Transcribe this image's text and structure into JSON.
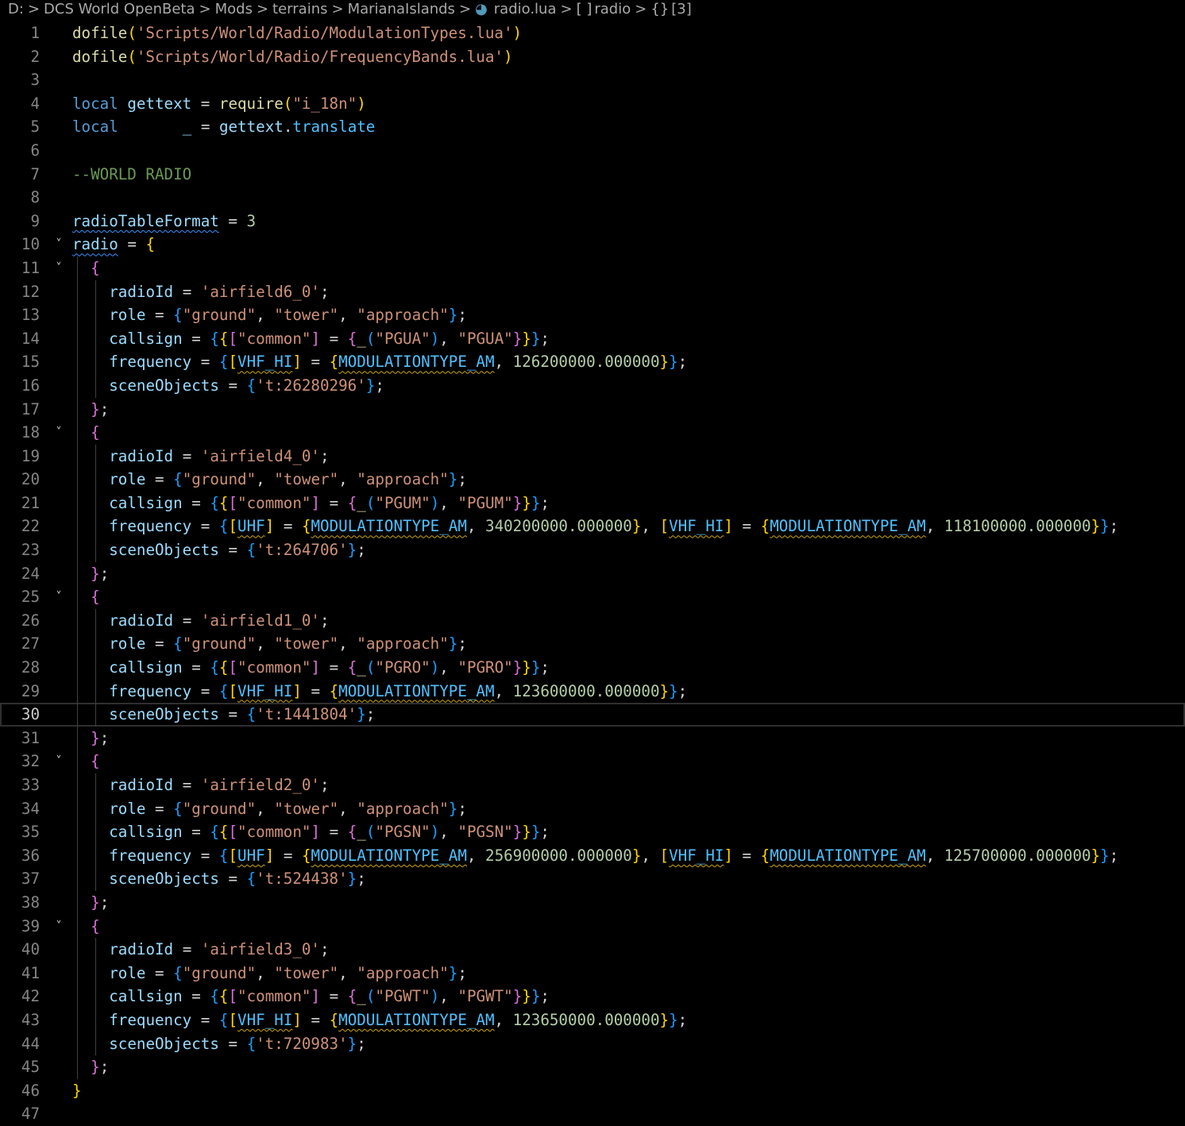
{
  "breadcrumb": {
    "items": [
      "D:",
      "DCS World OpenBeta",
      "Mods",
      "terrains",
      "MarianaIslands",
      "radio.lua",
      "radio",
      "[3]"
    ],
    "icons": {
      "file": "lua-file-icon",
      "array": "array-icon",
      "object": "object-icon"
    }
  },
  "editor": {
    "current_line": 30,
    "lines": [
      {
        "n": "1",
        "text": "dofile('Scripts/World/Radio/ModulationTypes.lua')"
      },
      {
        "n": "2",
        "text": "dofile('Scripts/World/Radio/FrequencyBands.lua')"
      },
      {
        "n": "3",
        "text": ""
      },
      {
        "n": "4",
        "text": "local gettext = require(\"i_18n\")"
      },
      {
        "n": "5",
        "text": "local       _ = gettext.translate"
      },
      {
        "n": "6",
        "text": ""
      },
      {
        "n": "7",
        "text": "--WORLD RADIO"
      },
      {
        "n": "8",
        "text": ""
      },
      {
        "n": "9",
        "text": "radioTableFormat = 3"
      },
      {
        "n": "10",
        "text": "radio = {"
      },
      {
        "n": "11",
        "text": "  {"
      },
      {
        "n": "12",
        "text": "    radioId = 'airfield6_0';"
      },
      {
        "n": "13",
        "text": "    role = {\"ground\", \"tower\", \"approach\"};"
      },
      {
        "n": "14",
        "text": "    callsign = {{[\"common\"] = {_(\"PGUA\"), \"PGUA\"}}};"
      },
      {
        "n": "15",
        "text": "    frequency = {[VHF_HI] = {MODULATIONTYPE_AM, 126200000.000000}};"
      },
      {
        "n": "16",
        "text": "    sceneObjects = {'t:26280296'};"
      },
      {
        "n": "17",
        "text": "  };"
      },
      {
        "n": "18",
        "text": "  {"
      },
      {
        "n": "19",
        "text": "    radioId = 'airfield4_0';"
      },
      {
        "n": "20",
        "text": "    role = {\"ground\", \"tower\", \"approach\"};"
      },
      {
        "n": "21",
        "text": "    callsign = {{[\"common\"] = {_(\"PGUM\"), \"PGUM\"}}};"
      },
      {
        "n": "22",
        "text": "    frequency = {[UHF] = {MODULATIONTYPE_AM, 340200000.000000}, [VHF_HI] = {MODULATIONTYPE_AM, 118100000.000000}};"
      },
      {
        "n": "23",
        "text": "    sceneObjects = {'t:264706'};"
      },
      {
        "n": "24",
        "text": "  };"
      },
      {
        "n": "25",
        "text": "  {"
      },
      {
        "n": "26",
        "text": "    radioId = 'airfield1_0';"
      },
      {
        "n": "27",
        "text": "    role = {\"ground\", \"tower\", \"approach\"};"
      },
      {
        "n": "28",
        "text": "    callsign = {{[\"common\"] = {_(\"PGRO\"), \"PGRO\"}}};"
      },
      {
        "n": "29",
        "text": "    frequency = {[VHF_HI] = {MODULATIONTYPE_AM, 123600000.000000}};"
      },
      {
        "n": "30",
        "text": "    sceneObjects = {'t:1441804'};"
      },
      {
        "n": "31",
        "text": "  };"
      },
      {
        "n": "32",
        "text": "  {"
      },
      {
        "n": "33",
        "text": "    radioId = 'airfield2_0';"
      },
      {
        "n": "34",
        "text": "    role = {\"ground\", \"tower\", \"approach\"};"
      },
      {
        "n": "35",
        "text": "    callsign = {{[\"common\"] = {_(\"PGSN\"), \"PGSN\"}}};"
      },
      {
        "n": "36",
        "text": "    frequency = {[UHF] = {MODULATIONTYPE_AM, 256900000.000000}, [VHF_HI] = {MODULATIONTYPE_AM, 125700000.000000}};"
      },
      {
        "n": "37",
        "text": "    sceneObjects = {'t:524438'};"
      },
      {
        "n": "38",
        "text": "  };"
      },
      {
        "n": "39",
        "text": "  {"
      },
      {
        "n": "40",
        "text": "    radioId = 'airfield3_0';"
      },
      {
        "n": "41",
        "text": "    role = {\"ground\", \"tower\", \"approach\"};"
      },
      {
        "n": "42",
        "text": "    callsign = {{[\"common\"] = {_(\"PGWT\"), \"PGWT\"}}};"
      },
      {
        "n": "43",
        "text": "    frequency = {[VHF_HI] = {MODULATIONTYPE_AM, 123650000.000000}};"
      },
      {
        "n": "44",
        "text": "    sceneObjects = {'t:720983'};"
      },
      {
        "n": "45",
        "text": "  };"
      },
      {
        "n": "46",
        "text": "}"
      },
      {
        "n": "47",
        "text": ""
      }
    ]
  }
}
